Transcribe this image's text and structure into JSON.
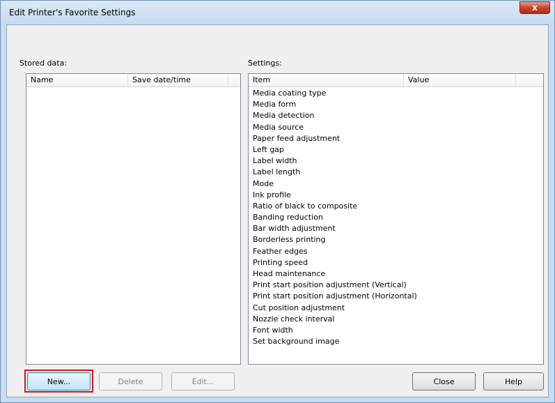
{
  "window": {
    "title": "Edit Printer's Favorite Settings",
    "close_glyph": "x"
  },
  "stored_data": {
    "label": "Stored data:",
    "columns": [
      "Name",
      "Save date/time"
    ],
    "rows": []
  },
  "settings": {
    "label": "Settings:",
    "columns": [
      "Item",
      "Value"
    ],
    "items": [
      "Media coating type",
      "Media form",
      "Media detection",
      "Media source",
      "Paper feed adjustment",
      "Left gap",
      "Label width",
      "Label length",
      "Mode",
      "Ink profile",
      "Ratio of black to composite",
      "Banding reduction",
      "Bar width adjustment",
      "Borderless printing",
      "Feather edges",
      "Printing speed",
      "Head maintenance",
      "Print start position adjustment (Vertical)",
      "Print start position adjustment (Horizontal)",
      "Cut position adjustment",
      "Nozzle check interval",
      "Font width",
      "Set background image"
    ]
  },
  "buttons": {
    "new": "New...",
    "delete": "Delete",
    "edit": "Edit...",
    "close": "Close",
    "help": "Help"
  },
  "colors": {
    "highlight": "#d0121b"
  }
}
